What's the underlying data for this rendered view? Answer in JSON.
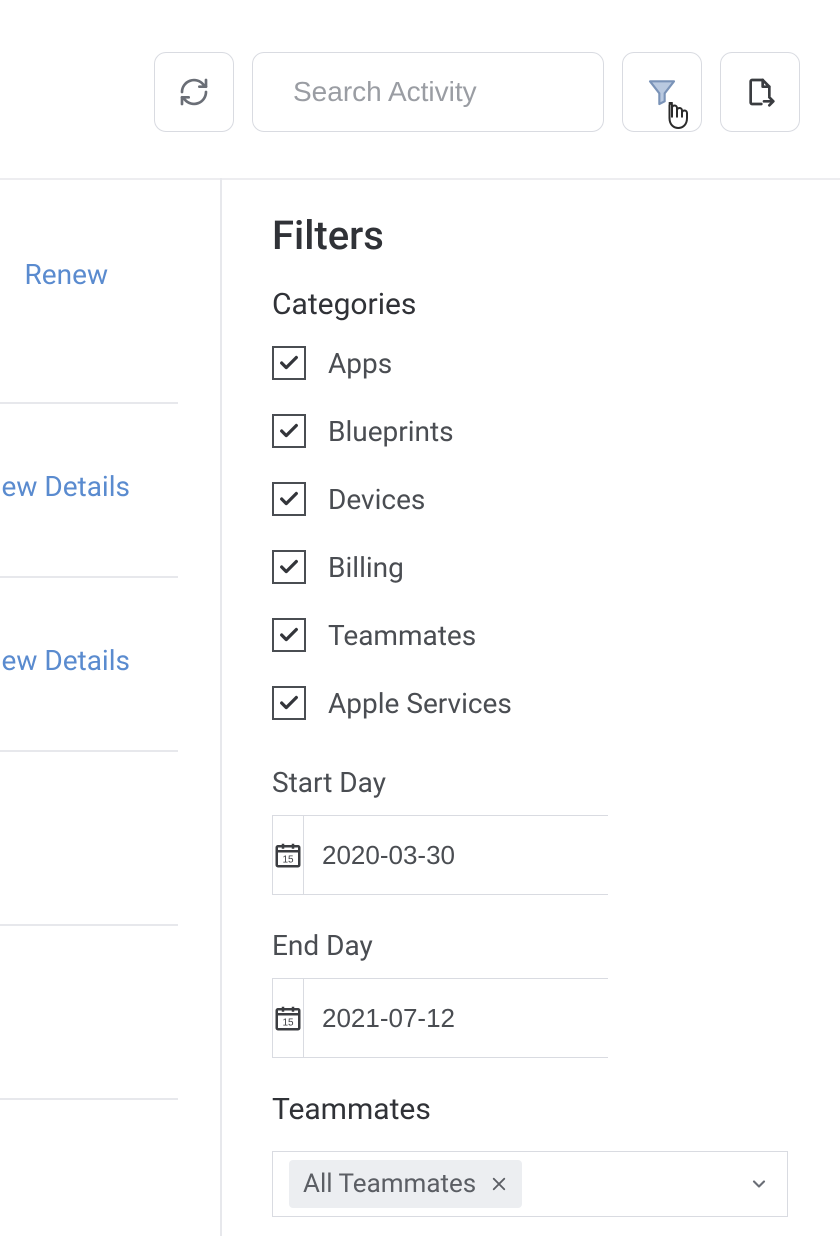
{
  "toolbar": {
    "search_placeholder": "Search Activity"
  },
  "left": {
    "renew_label": "Renew",
    "view_details_1": "iew Details",
    "view_details_2": "iew Details"
  },
  "filters": {
    "title": "Filters",
    "categories_title": "Categories",
    "categories": [
      {
        "label": "Apps",
        "checked": true
      },
      {
        "label": "Blueprints",
        "checked": true
      },
      {
        "label": "Devices",
        "checked": true
      },
      {
        "label": "Billing",
        "checked": true
      },
      {
        "label": "Teammates",
        "checked": true
      },
      {
        "label": "Apple Services",
        "checked": true
      }
    ],
    "start_day_label": "Start Day",
    "start_day": "2020-03-30",
    "end_day_label": "End Day",
    "end_day": "2021-07-12",
    "teammates_title": "Teammates",
    "teammates_selected": "All Teammates"
  }
}
